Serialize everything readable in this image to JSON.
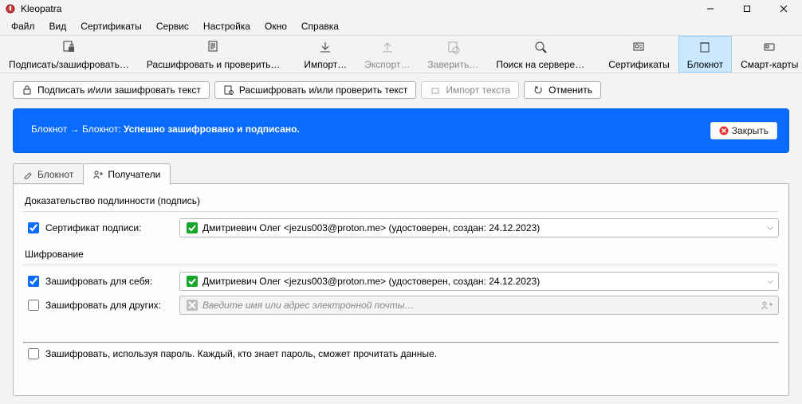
{
  "titlebar": {
    "app_name": "Kleopatra"
  },
  "menu": {
    "file": "Файл",
    "view": "Вид",
    "certificates": "Сертификаты",
    "service": "Сервис",
    "settings": "Настройка",
    "window": "Окно",
    "help": "Справка"
  },
  "toolbar": {
    "sign_encrypt": "Подписать/зашифровать…",
    "decrypt_verify": "Расшифровать и проверить…",
    "import": "Импорт…",
    "export": "Экспорт…",
    "certify": "Заверить…",
    "lookup": "Поиск на сервере…",
    "certificates": "Сертификаты",
    "notepad": "Блокнот",
    "smartcards": "Смарт-карты"
  },
  "actionbar": {
    "sign_encrypt_text": "Подписать и/или зашифровать текст",
    "decrypt_verify_text": "Расшифровать и/или проверить текст",
    "import_text": "Импорт текста",
    "revert": "Отменить"
  },
  "banner": {
    "prefix": "Блокнот → Блокнот:",
    "message": "Успешно зашифровано и подписано.",
    "close": "Закрыть"
  },
  "tabs": {
    "notepad": "Блокнот",
    "recipients": "Получатели"
  },
  "signing": {
    "group_label": "Доказательство подлинности (подпись)",
    "cert_label": "Сертификат подписи:",
    "cert_value": "Дмитриевич Олег <jezus003@proton.me> (удостоверен, создан: 24.12.2023)"
  },
  "encryption": {
    "group_label": "Шифрование",
    "self_label": "Зашифровать для себя:",
    "self_value": "Дмитриевич Олег <jezus003@proton.me> (удостоверен, создан: 24.12.2023)",
    "others_label": "Зашифровать для других:",
    "others_placeholder": "Введите имя или адрес электронной почты…",
    "password_label": "Зашифровать, используя пароль. Каждый, кто знает пароль, сможет прочитать данные."
  }
}
